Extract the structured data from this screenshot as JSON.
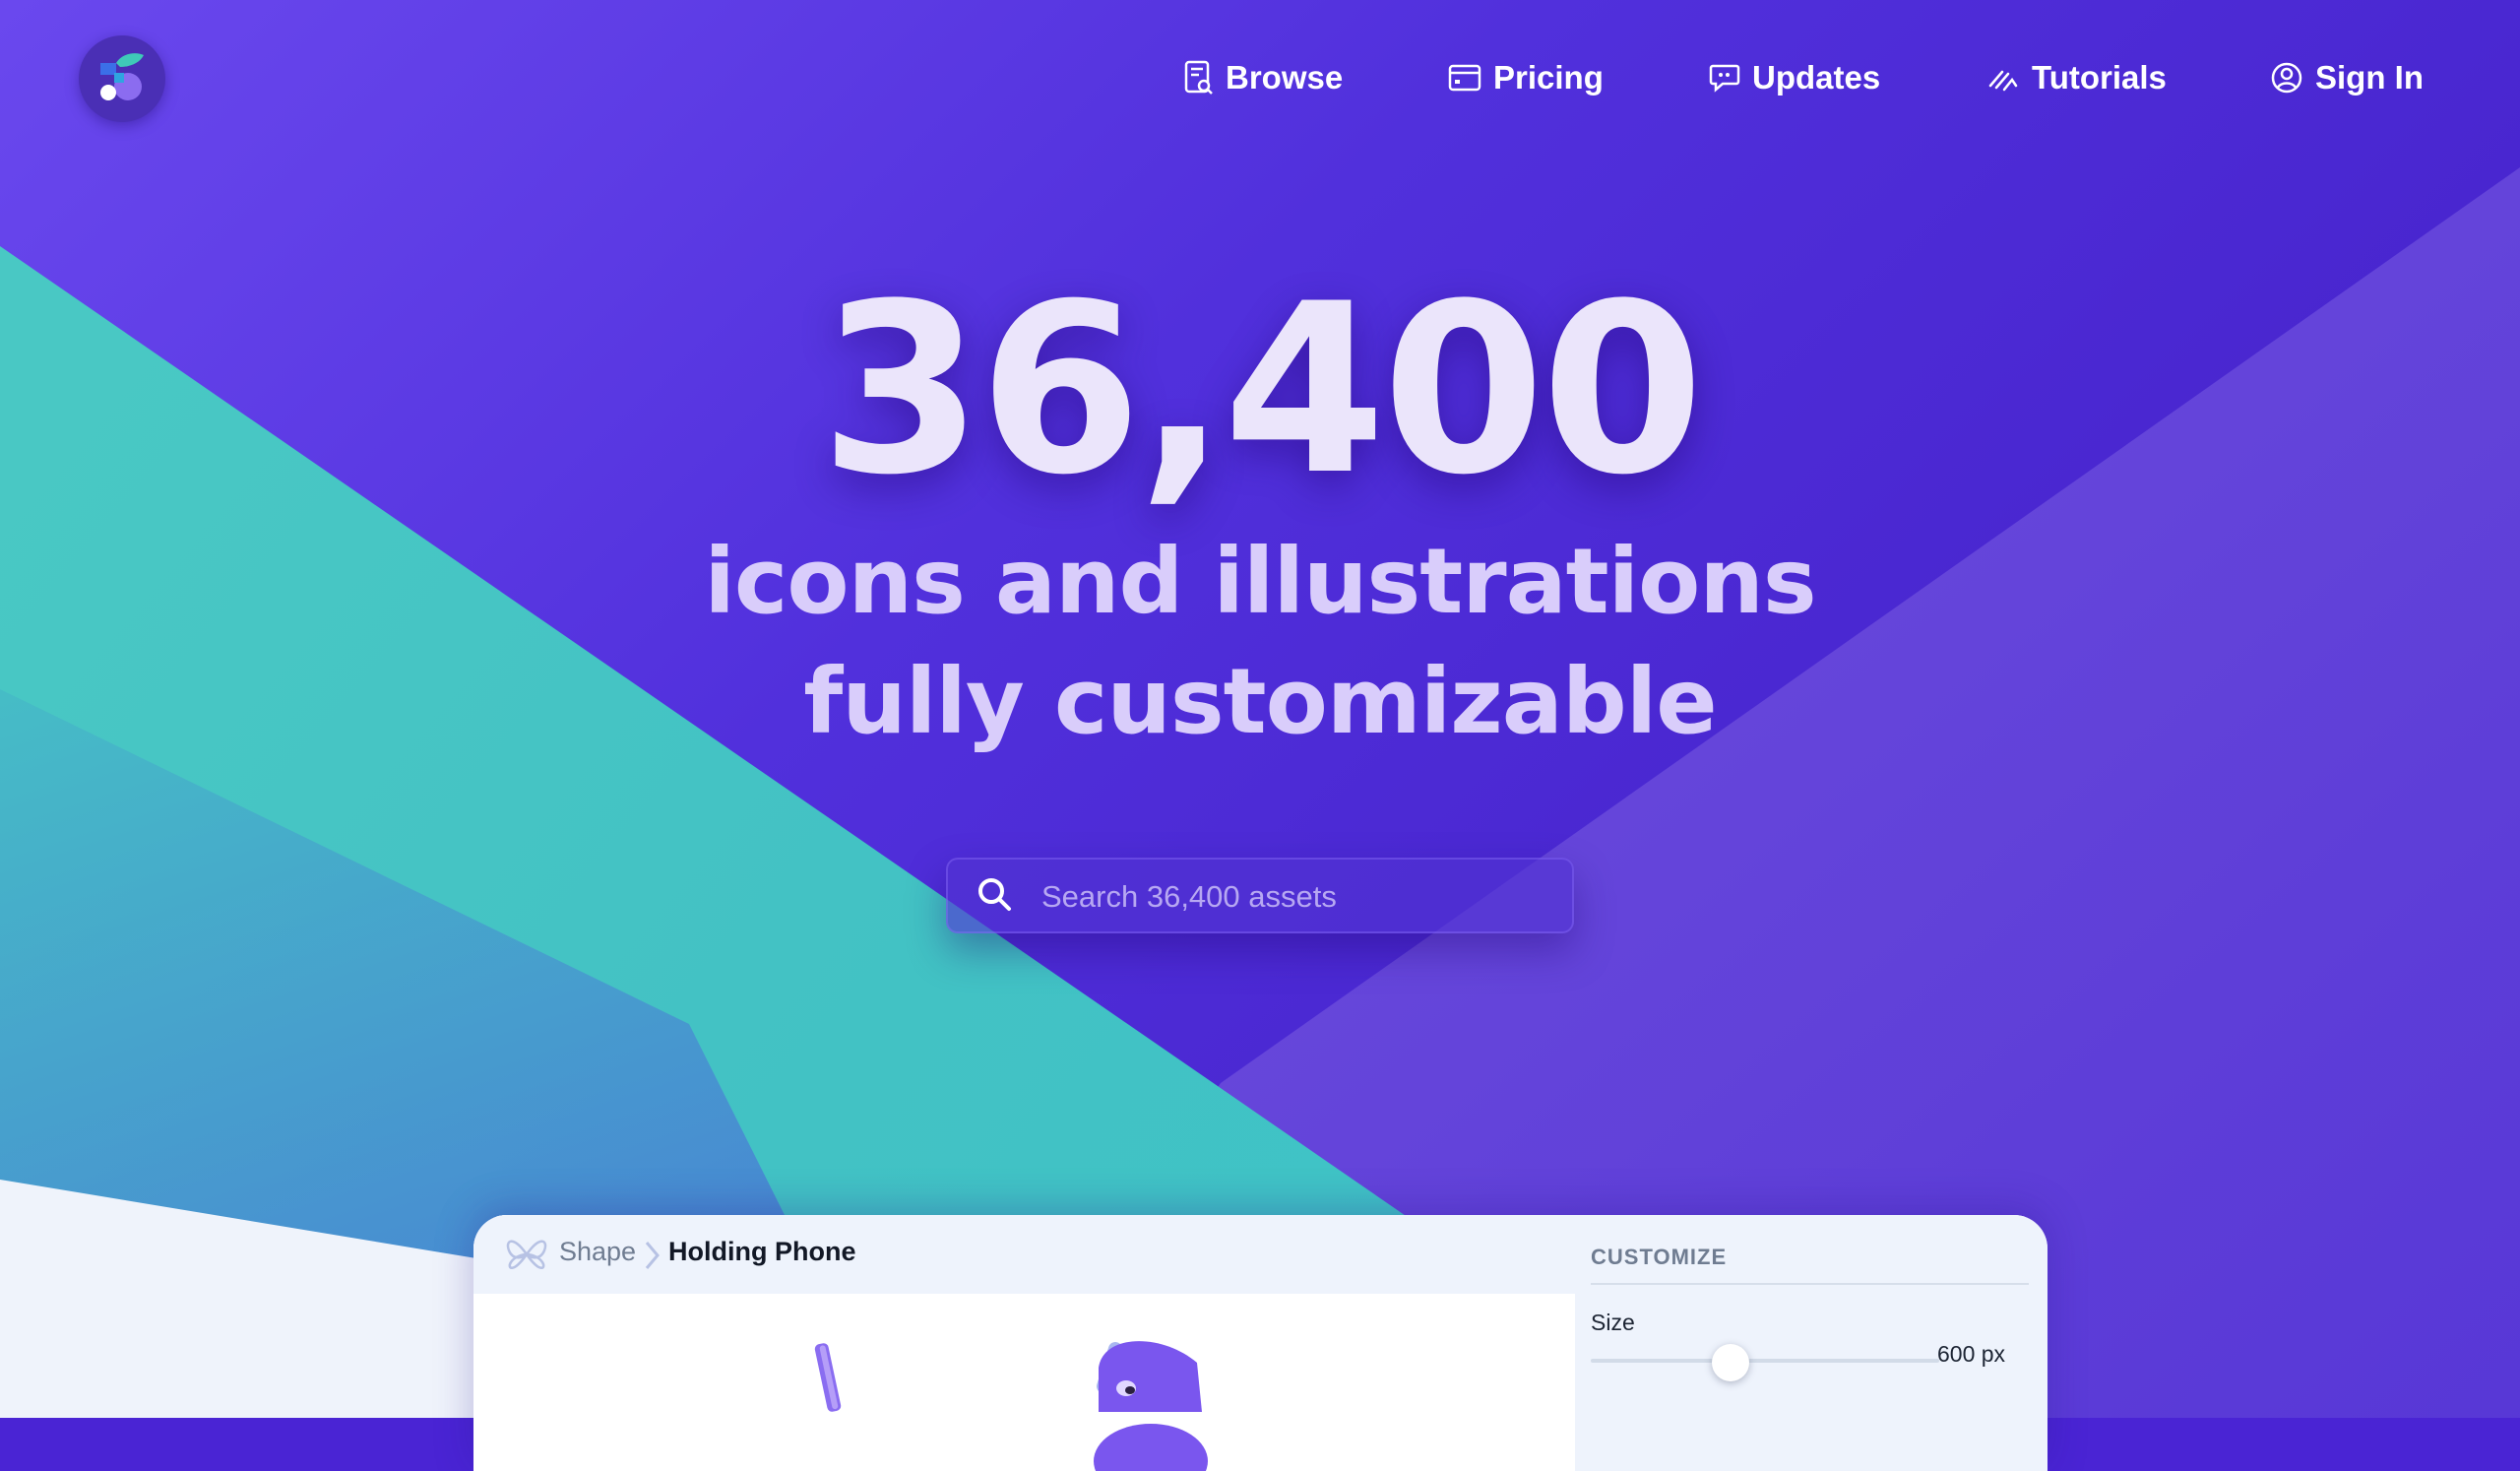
{
  "theme": {
    "accent": "#5a2fe0",
    "teal": "#45c2c0",
    "text_light": "#ebe5fb"
  },
  "header": {
    "logo": "brand-logo",
    "nav": [
      {
        "label": "Browse",
        "icon": "browse-icon"
      },
      {
        "label": "Pricing",
        "icon": "card-icon"
      },
      {
        "label": "Updates",
        "icon": "speech-bubble-icon"
      },
      {
        "label": "Tutorials",
        "icon": "pen-icon"
      },
      {
        "label": "Sign In",
        "icon": "user-icon"
      }
    ]
  },
  "hero": {
    "count": "36,400",
    "line1": "icons and illustrations",
    "line2": "fully customizable"
  },
  "search": {
    "placeholder": "Search 36,400 assets",
    "icon": "search-icon"
  },
  "preview": {
    "breadcrumb": {
      "root": "Shape",
      "current": "Holding Phone"
    },
    "customize": {
      "title": "CUSTOMIZE",
      "size_label": "Size",
      "size_value": "600 px",
      "size_fraction": 0.4
    }
  }
}
